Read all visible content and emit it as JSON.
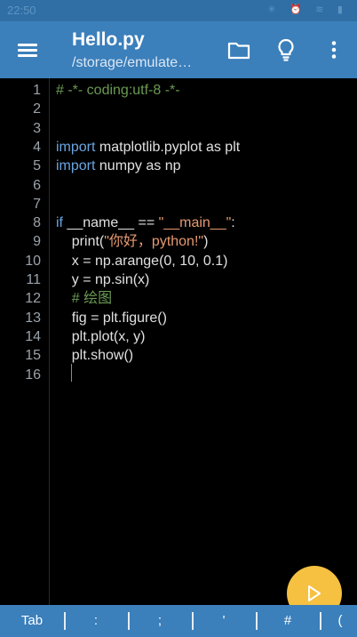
{
  "status": {
    "time": "22:50",
    "icons": "✳ ⏰ ≋ ▮"
  },
  "appbar": {
    "title": "Hello.py",
    "subtitle": "/storage/emulate…"
  },
  "editor": {
    "lines": [
      {
        "n": "1",
        "tokens": [
          {
            "t": "comment",
            "v": "# -*- coding:utf-8 -*-"
          }
        ]
      },
      {
        "n": "2",
        "tokens": []
      },
      {
        "n": "3",
        "tokens": []
      },
      {
        "n": "4",
        "tokens": [
          {
            "t": "keyword",
            "v": "import"
          },
          {
            "t": "plain",
            "v": " matplotlib.pyplot as plt"
          }
        ]
      },
      {
        "n": "5",
        "tokens": [
          {
            "t": "keyword",
            "v": "import"
          },
          {
            "t": "plain",
            "v": " numpy as np"
          }
        ]
      },
      {
        "n": "6",
        "tokens": []
      },
      {
        "n": "7",
        "tokens": []
      },
      {
        "n": "8",
        "tokens": [
          {
            "t": "keyword",
            "v": "if"
          },
          {
            "t": "plain",
            "v": " __name__ == "
          },
          {
            "t": "string",
            "v": "\"__main__\""
          },
          {
            "t": "plain",
            "v": ":"
          }
        ]
      },
      {
        "n": "9",
        "tokens": [
          {
            "t": "plain",
            "v": "    print("
          },
          {
            "t": "string",
            "v": "\"你好，python!\""
          },
          {
            "t": "plain",
            "v": ")"
          }
        ]
      },
      {
        "n": "10",
        "tokens": [
          {
            "t": "plain",
            "v": "    x = np.arange(0, 10, 0.1)"
          }
        ]
      },
      {
        "n": "11",
        "tokens": [
          {
            "t": "plain",
            "v": "    y = np.sin(x)"
          }
        ]
      },
      {
        "n": "12",
        "tokens": [
          {
            "t": "comment",
            "v": "    # 绘图"
          }
        ]
      },
      {
        "n": "13",
        "tokens": [
          {
            "t": "plain",
            "v": "    fig = plt.figure()"
          }
        ]
      },
      {
        "n": "14",
        "tokens": [
          {
            "t": "plain",
            "v": "    plt.plot(x, y)"
          }
        ]
      },
      {
        "n": "15",
        "tokens": [
          {
            "t": "plain",
            "v": "    plt.show()"
          }
        ]
      },
      {
        "n": "16",
        "tokens": []
      }
    ]
  },
  "keybar": {
    "keys": [
      "Tab",
      ":",
      ";",
      "'",
      "#",
      "("
    ]
  },
  "colors": {
    "appbar": "#3b7fbb",
    "fab": "#f6c040",
    "keyword": "#6aa6e0",
    "string": "#e69a70",
    "comment": "#6a9a52"
  },
  "icons": [
    "menu-icon",
    "folder-icon",
    "lightbulb-icon",
    "more-vert-icon",
    "play-icon"
  ]
}
